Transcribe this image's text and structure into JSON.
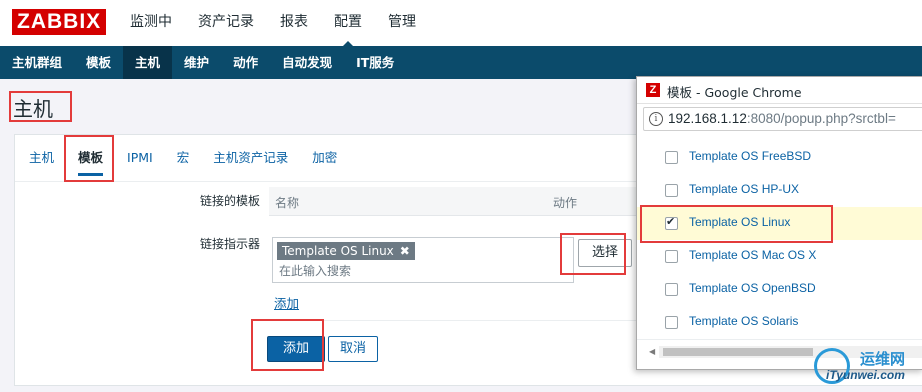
{
  "header": {
    "logo": "ZABBIX",
    "menu": [
      "监测中",
      "资产记录",
      "报表",
      "配置",
      "管理"
    ],
    "active_menu": 3
  },
  "subnav": {
    "items": [
      "主机群组",
      "模板",
      "主机",
      "维护",
      "动作",
      "自动发现",
      "IT服务"
    ],
    "active": 2
  },
  "page": {
    "title": "主机",
    "tabs": [
      "主机",
      "模板",
      "IPMI",
      "宏",
      "主机资产记录",
      "加密"
    ],
    "active_tab": 1,
    "linked_templates_label": "链接的模板",
    "table_headers": {
      "name": "名称",
      "action": "动作"
    },
    "link_indicator_label": "链接指示器",
    "selected_template": "Template OS Linux",
    "remove_chip": "✖",
    "search_placeholder": "在此输入搜索",
    "select_button": "选择",
    "add_link": "添加",
    "submit_button": "添加",
    "cancel_button": "取消"
  },
  "popup": {
    "window_title": "模板 - Google Chrome",
    "url_host": "192.168.1.12",
    "url_rest": ":8080/popup.php?srctbl=",
    "items": [
      {
        "name": "Template OS FreeBSD",
        "checked": false
      },
      {
        "name": "Template OS HP-UX",
        "checked": false
      },
      {
        "name": "Template OS Linux",
        "checked": true
      },
      {
        "name": "Template OS Mac OS X",
        "checked": false
      },
      {
        "name": "Template OS OpenBSD",
        "checked": false
      },
      {
        "name": "Template OS Solaris",
        "checked": false
      }
    ]
  },
  "watermark": {
    "line1": "运维网",
    "line2": "iTyunwei.com"
  },
  "colors": {
    "brand_red": "#d40000",
    "nav_blue": "#0b4b6b",
    "link_blue": "#0b62a4",
    "highlight_box": "#e33b3b"
  }
}
